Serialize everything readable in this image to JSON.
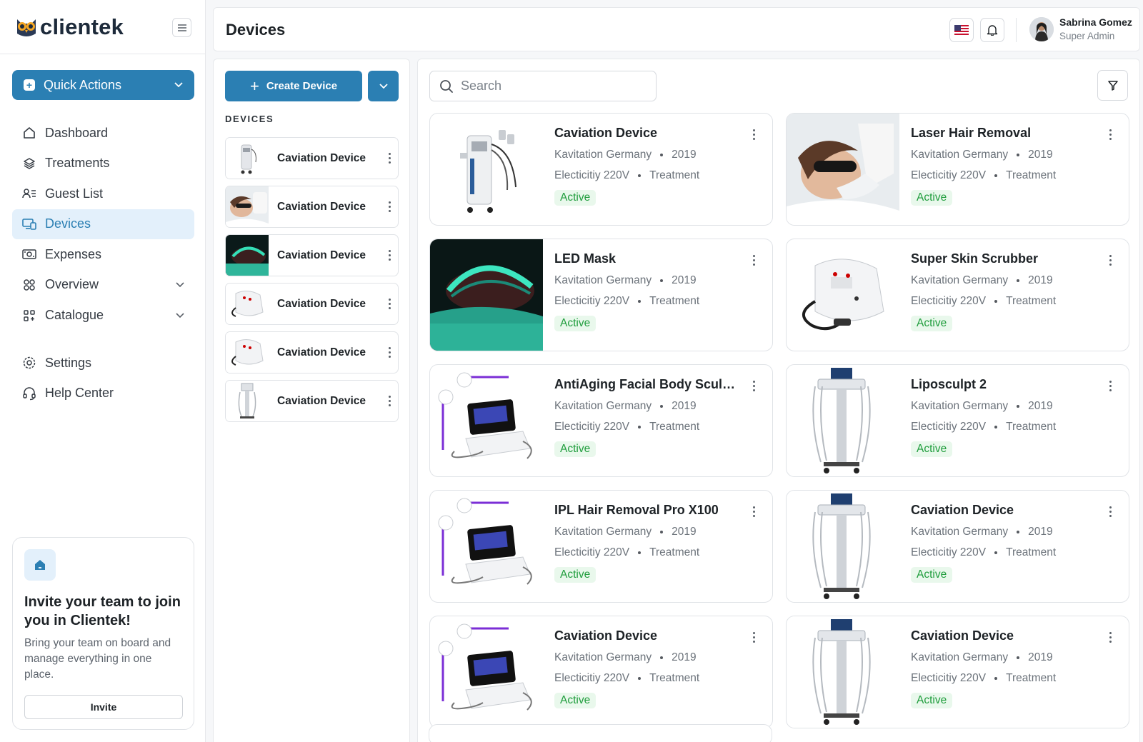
{
  "app": {
    "brand": "clientek",
    "page_title": "Devices"
  },
  "sidebar": {
    "quick_actions": "Quick Actions",
    "items": [
      {
        "label": "Dashboard",
        "icon": "home-icon"
      },
      {
        "label": "Treatments",
        "icon": "layers-icon"
      },
      {
        "label": "Guest List",
        "icon": "guest-list-icon"
      },
      {
        "label": "Devices",
        "icon": "devices-icon",
        "active": true
      },
      {
        "label": "Expenses",
        "icon": "banknote-icon"
      },
      {
        "label": "Overview",
        "icon": "grid-icon",
        "expandable": true
      },
      {
        "label": "Catalogue",
        "icon": "catalogue-icon",
        "expandable": true
      },
      {
        "label": "Settings",
        "icon": "gear-icon"
      },
      {
        "label": "Help Center",
        "icon": "headset-icon"
      }
    ],
    "invite": {
      "title": "Invite your team to join you in Clientek!",
      "text": "Bring your team on board and manage everything in one place.",
      "button": "Invite"
    }
  },
  "header": {
    "user_name": "Sabrina Gomez",
    "user_role": "Super Admin"
  },
  "list_panel": {
    "create_button": "Create Device",
    "section_label": "DEVICES",
    "items": [
      {
        "name": "Caviation Device",
        "thumb": "cavitation-machine"
      },
      {
        "name": "Caviation Device",
        "thumb": "laser-face"
      },
      {
        "name": "Caviation Device",
        "thumb": "led-mask"
      },
      {
        "name": "Caviation Device",
        "thumb": "scrubber"
      },
      {
        "name": "Caviation Device",
        "thumb": "scrubber"
      },
      {
        "name": "Caviation Device",
        "thumb": "liposculpt"
      }
    ]
  },
  "grid": {
    "search_placeholder": "Search",
    "cards": [
      {
        "name": "Caviation Device",
        "brand": "Kavitation Germany",
        "year": "2019",
        "power": "Electicitiy 220V",
        "category": "Treatment",
        "status": "Active",
        "image": "cavitation-machine"
      },
      {
        "name": "Laser Hair Removal",
        "brand": "Kavitation Germany",
        "year": "2019",
        "power": "Electicitiy 220V",
        "category": "Treatment",
        "status": "Active",
        "image": "laser-face"
      },
      {
        "name": "LED Mask",
        "brand": "Kavitation Germany",
        "year": "2019",
        "power": "Electicitiy 220V",
        "category": "Treatment",
        "status": "Active",
        "image": "led-mask"
      },
      {
        "name": "Super Skin Scrubber",
        "brand": "Kavitation Germany",
        "year": "2019",
        "power": "Electicitiy 220V",
        "category": "Treatment",
        "status": "Active",
        "image": "scrubber"
      },
      {
        "name": "AntiAging Facial Body Sculpti...",
        "brand": "Kavitation Germany",
        "year": "2019",
        "power": "Electicitiy 220V",
        "category": "Treatment",
        "status": "Active",
        "image": "tablet-device"
      },
      {
        "name": "Liposculpt 2",
        "brand": "Kavitation Germany",
        "year": "2019",
        "power": "Electicitiy 220V",
        "category": "Treatment",
        "status": "Active",
        "image": "liposculpt"
      },
      {
        "name": "IPL Hair Removal Pro X100",
        "brand": "Kavitation Germany",
        "year": "2019",
        "power": "Electicitiy 220V",
        "category": "Treatment",
        "status": "Active",
        "image": "tablet-device"
      },
      {
        "name": "Caviation Device",
        "brand": "Kavitation Germany",
        "year": "2019",
        "power": "Electicitiy 220V",
        "category": "Treatment",
        "status": "Active",
        "image": "liposculpt"
      },
      {
        "name": "Caviation Device",
        "brand": "Kavitation Germany",
        "year": "2019",
        "power": "Electicitiy 220V",
        "category": "Treatment",
        "status": "Active",
        "image": "tablet-device"
      },
      {
        "name": "Caviation Device",
        "brand": "Kavitation Germany",
        "year": "2019",
        "power": "Electicitiy 220V",
        "category": "Treatment",
        "status": "Active",
        "image": "liposculpt"
      }
    ]
  },
  "colors": {
    "accent": "#2b7fb3",
    "active_nav_bg": "#e3f0fb",
    "status_active": "#1f9d3c",
    "status_active_bg": "#e9f8ec"
  }
}
